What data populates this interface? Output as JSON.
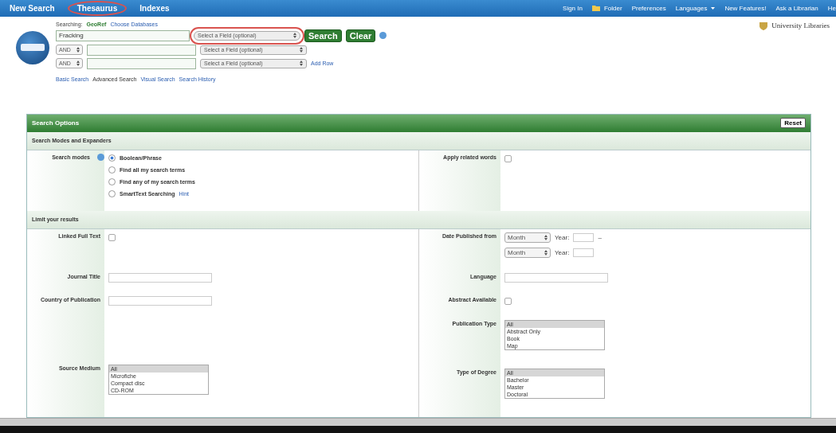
{
  "top_nav": {
    "left": [
      {
        "label": "New Search",
        "circled": false
      },
      {
        "label": "Thesaurus",
        "circled": true
      },
      {
        "label": "Indexes",
        "circled": false
      }
    ],
    "right": [
      {
        "label": "Sign In",
        "kind": "link"
      },
      {
        "label": "Folder",
        "kind": "folder"
      },
      {
        "label": "Preferences",
        "kind": "link"
      },
      {
        "label": "Languages",
        "kind": "menu"
      },
      {
        "label": "New Features!",
        "kind": "link"
      },
      {
        "label": "Ask a Librarian",
        "kind": "link"
      },
      {
        "label": "He",
        "kind": "link"
      }
    ]
  },
  "header": {
    "searching_label": "Searching:",
    "database": "GeoRef",
    "choose_databases": "Choose Databases",
    "library_name": "University Libraries"
  },
  "search_rows": [
    {
      "term": "Fracking",
      "field": "Select a Field (optional)",
      "circled": true
    },
    {
      "operator": "AND",
      "term": "",
      "field": "Select a Field (optional)",
      "circled": false
    },
    {
      "operator": "AND",
      "term": "",
      "field": "Select a Field (optional)",
      "circled": false
    }
  ],
  "buttons": [
    "Search",
    "Clear"
  ],
  "add_row": "Add Row",
  "search_links": [
    {
      "label": "Basic Search",
      "selected": false
    },
    {
      "label": "Advanced Search",
      "selected": true
    },
    {
      "label": "Visual Search",
      "selected": false
    },
    {
      "label": "Search History",
      "selected": false
    }
  ],
  "options": {
    "title": "Search Options",
    "reset": "Reset",
    "modes_heading": "Search Modes and Expanders",
    "modes_label": "Search modes",
    "modes": [
      {
        "label": "Boolean/Phrase",
        "selected": true
      },
      {
        "label": "Find all my search terms",
        "selected": false
      },
      {
        "label": "Find any of my search terms",
        "selected": false
      },
      {
        "label": "SmartText Searching",
        "selected": false
      }
    ],
    "hint": "Hint",
    "related_label": "Apply related words",
    "related_checked": false,
    "limits_heading": "Limit your results",
    "left_limits": [
      {
        "kind": "checkbox",
        "label": "Linked Full Text",
        "checked": false
      },
      {
        "kind": "text",
        "label": "Journal Title"
      },
      {
        "kind": "text",
        "label": "Country of Publication"
      },
      {
        "kind": "list",
        "label": "Source Medium",
        "options": [
          {
            "label": "All",
            "selected": true
          },
          {
            "label": "Microfiche",
            "selected": false
          },
          {
            "label": "Compact disc",
            "selected": false
          },
          {
            "label": "CD-ROM",
            "selected": false
          }
        ]
      }
    ],
    "right_limits": [
      {
        "kind": "date",
        "label": "Date Published from",
        "rows": [
          {
            "month": "Month",
            "year_label": "Year:",
            "dash": "–"
          },
          {
            "month": "Month",
            "year_label": "Year:"
          }
        ]
      },
      {
        "kind": "text",
        "label": "Language"
      },
      {
        "kind": "checkbox",
        "label": "Abstract Available",
        "checked": false
      },
      {
        "kind": "list",
        "label": "Publication Type",
        "options": [
          {
            "label": "All",
            "selected": true
          },
          {
            "label": "Abstract Only",
            "selected": false
          },
          {
            "label": "Book",
            "selected": false
          },
          {
            "label": "Map",
            "selected": false
          }
        ]
      },
      {
        "kind": "list",
        "label": "Type of Degree",
        "options": [
          {
            "label": "All",
            "selected": true
          },
          {
            "label": "Bachelor",
            "selected": false
          },
          {
            "label": "Master",
            "selected": false
          },
          {
            "label": "Doctoral",
            "selected": false
          }
        ]
      }
    ]
  }
}
